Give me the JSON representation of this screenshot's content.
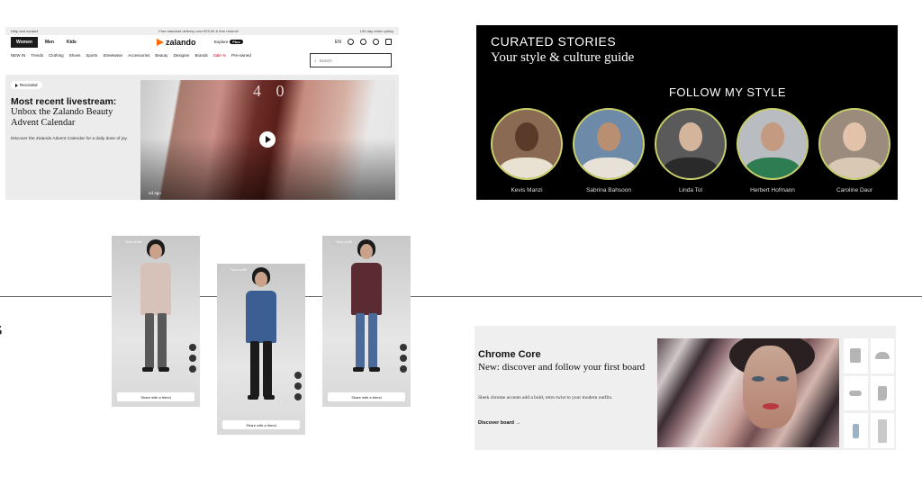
{
  "zalando": {
    "topbar": {
      "left": "Help and contact",
      "center": "Free standard delivery over €29,90 & free returns*",
      "right": "100-day return policy"
    },
    "tabs": [
      "Women",
      "Men",
      "Kids"
    ],
    "logo": "zalando",
    "explore": "Explore",
    "plus_badge": "Plus",
    "lang": "EN",
    "nav": [
      "NEW IN",
      "Trends",
      "Clothing",
      "Shoes",
      "Sports",
      "Streetwear",
      "Accessories",
      "Beauty",
      "Designer",
      "Brands",
      "Sale %",
      "Pre-owned"
    ],
    "search_placeholder": "Search",
    "recorded_label": "Recorded",
    "hero_title": "Most recent livestream:",
    "hero_subtitle": "Unbox the Zalando Beauty Advent Calendar",
    "hero_desc": "Discover the Zalando Advent Calendar for a daily dose of joy.",
    "video_numbers": "4 0",
    "time_ago": "4d ago"
  },
  "curated": {
    "title": "CURATED STORIES",
    "subtitle": "Your style & culture guide",
    "section": "FOLLOW MY STYLE",
    "people": [
      {
        "name": "Kevis Manzi",
        "bg": "#8a6a52",
        "face": "#5a3a28",
        "body": "#e9e2d2"
      },
      {
        "name": "Sabrina Bahsoon",
        "bg": "#6d8aa8",
        "face": "#b88f70",
        "body": "#e7e1d8"
      },
      {
        "name": "Linda Tol",
        "bg": "#5a5a5a",
        "face": "#d3b59c",
        "body": "#2a2a2a"
      },
      {
        "name": "Herbert Hofmann",
        "bg": "#b9bcc0",
        "face": "#c49a80",
        "body": "#2e7d52"
      },
      {
        "name": "Caroline Daur",
        "bg": "#9a8b7d",
        "face": "#e2c2a8",
        "body": "#d9c9b4"
      }
    ]
  },
  "phones": {
    "header_label": "Your outfit",
    "button_label": "Share with a friend",
    "items": [
      {
        "top": "#d6c2b9",
        "legs": "#595959",
        "shoes": "#1b1b1b"
      },
      {
        "top": "#3c5f93",
        "legs": "#1b1b1b",
        "shoes": "#2a2a2a"
      },
      {
        "top": "#5a2b33",
        "legs": "#4a6a9a",
        "shoes": "#2a2a2a"
      }
    ]
  },
  "chrome": {
    "title": "Chrome Core",
    "subtitle": "New: discover and follow your first board",
    "desc": "Sleek chrome accents add a bold, retro twist to your modern outfits.",
    "link": "Discover board →"
  }
}
